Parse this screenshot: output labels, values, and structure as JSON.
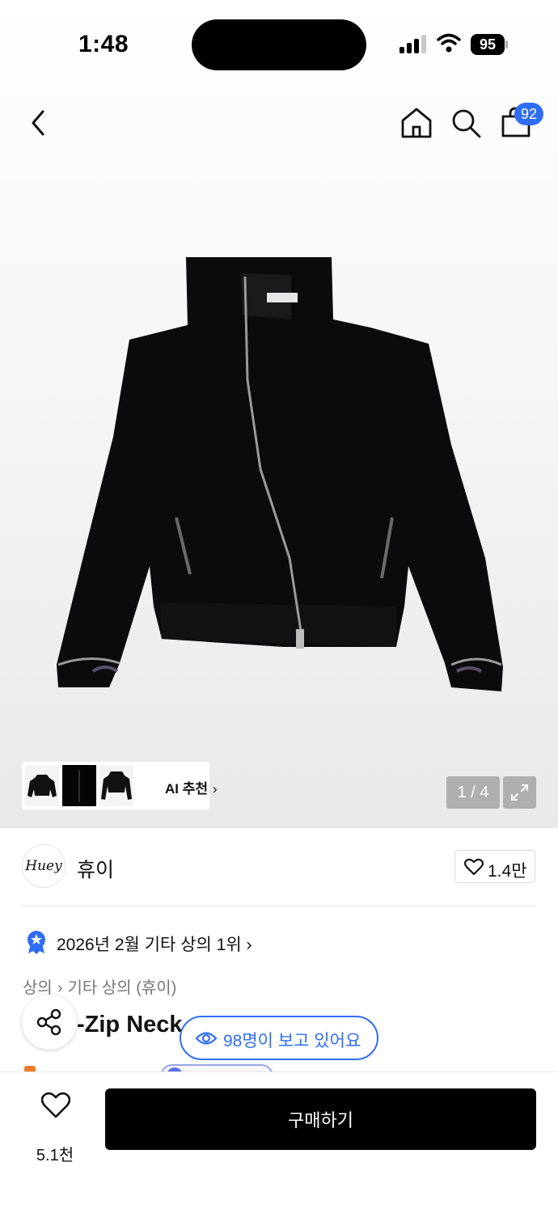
{
  "status_bar": {
    "time": "1:48",
    "battery": "95"
  },
  "header": {
    "cart_count": "92",
    "icons": [
      "back-icon",
      "home-icon",
      "search-icon",
      "cart-icon"
    ]
  },
  "gallery": {
    "ai_recommend_label": "AI 추천",
    "page_indicator": "1 / 4"
  },
  "brand": {
    "logo_text": "Huey",
    "name": "휴이",
    "like_count": "1.4만"
  },
  "ranking": {
    "text": "2026년 2월 기타 상의 1위"
  },
  "breadcrumb": {
    "level1": "상의",
    "level2": "기타 상의 (휴이)"
  },
  "product": {
    "title_visible": "-Zip Neck "
  },
  "viewers": {
    "label": "98명이 보고 있어요"
  },
  "bottom_bar": {
    "wish_count": "5.1천",
    "buy_label": "구매하기"
  },
  "colors": {
    "accent": "#2f6df6",
    "buy_button": "#000000",
    "indicator_bg": "#969696"
  }
}
